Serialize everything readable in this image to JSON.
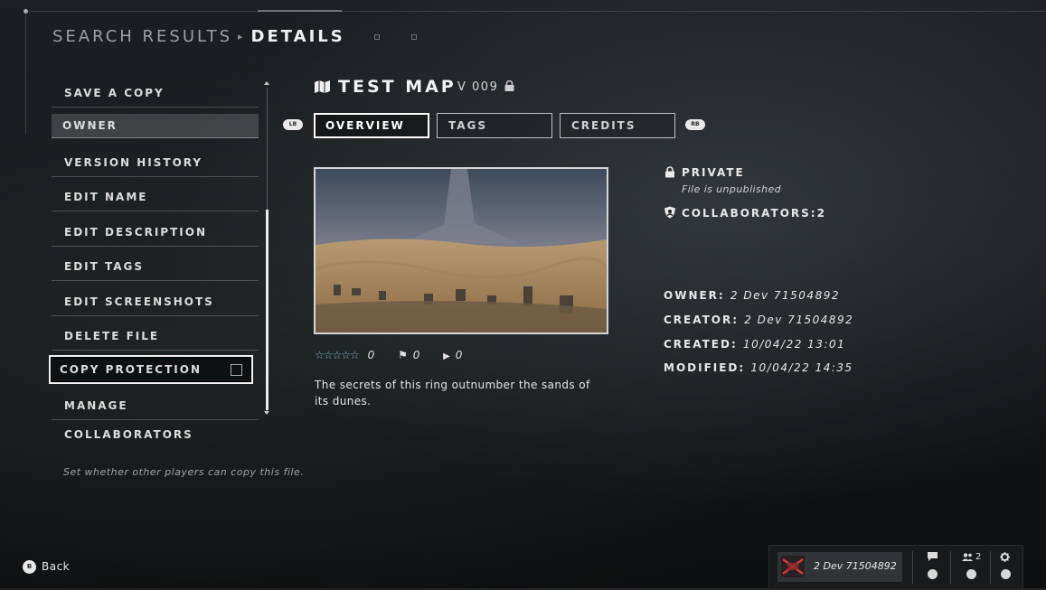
{
  "breadcrumb": {
    "parent": "SEARCH RESULTS",
    "separator": "▸",
    "current": "DETAILS"
  },
  "menu": {
    "items": [
      {
        "label": "SAVE A COPY"
      },
      {
        "label": "OWNER"
      },
      {
        "label": "VERSION HISTORY"
      },
      {
        "label": "EDIT NAME"
      },
      {
        "label": "EDIT DESCRIPTION"
      },
      {
        "label": "EDIT TAGS"
      },
      {
        "label": "EDIT SCREENSHOTS"
      },
      {
        "label": "DELETE FILE"
      },
      {
        "label": "COPY PROTECTION",
        "checked": false
      },
      {
        "label": "MANAGE COLLABORATORS"
      }
    ],
    "hint": "Set whether other players can copy this file."
  },
  "map": {
    "title": "TEST MAP",
    "version": "V 009",
    "description": "The secrets of this ring outnumber the sands of its dunes.",
    "stars": "☆☆☆☆☆",
    "rating": "0",
    "bookmarks": "0",
    "plays": "0"
  },
  "tabs": {
    "left_bumper": "LB",
    "right_bumper": "RB",
    "items": [
      {
        "label": "OVERVIEW"
      },
      {
        "label": "TAGS"
      },
      {
        "label": "CREDITS"
      }
    ]
  },
  "info": {
    "privacy": "PRIVATE",
    "privacy_sub": "File is unpublished",
    "collaborators_label": "COLLABORATORS:",
    "collaborators_count": "2",
    "owner_label": "OWNER:",
    "owner": "2 Dev 71504892",
    "creator_label": "CREATOR:",
    "creator": "2 Dev 71504892",
    "created_label": "CREATED:",
    "created": "10/04/22 13:01",
    "modified_label": "MODIFIED:",
    "modified": "10/04/22 14:35"
  },
  "footer": {
    "back_button": "B",
    "back_label": "Back",
    "player_name": "2 Dev 71504892",
    "friends_count": "2"
  },
  "colors": {
    "accent_star": "#7fb6cf",
    "focus_border": "#ffffff"
  }
}
